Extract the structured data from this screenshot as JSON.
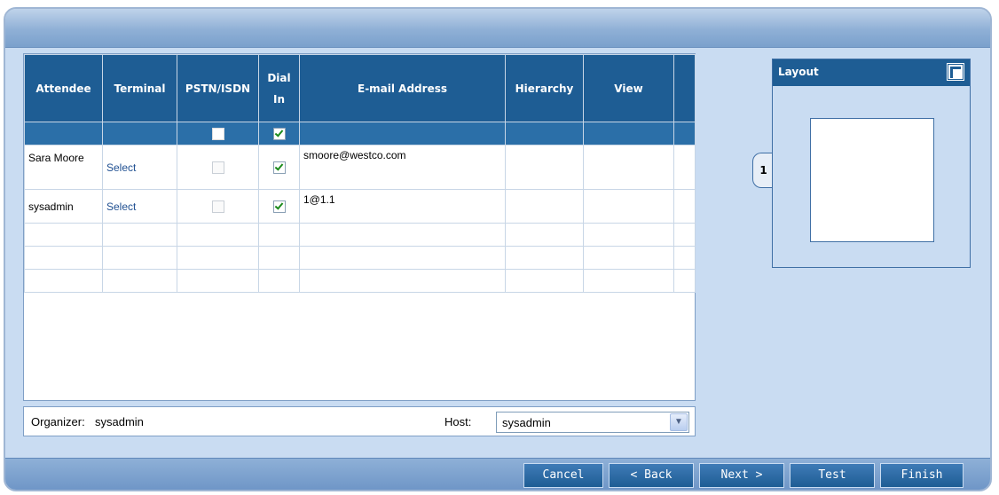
{
  "table": {
    "headers": [
      "Attendee",
      "Terminal",
      "PSTN/ISDN",
      "Dial In",
      "E-mail Address",
      "Hierarchy",
      "View"
    ],
    "select_all": {
      "pstn_checked": false,
      "dial_in_checked": true
    },
    "rows": [
      {
        "attendee": "Sara Moore",
        "terminal": "Select",
        "pstn_checked": false,
        "dial_in_checked": true,
        "email": "smoore@westco.com",
        "hierarchy": "",
        "view": ""
      },
      {
        "attendee": "sysadmin",
        "terminal": "Select",
        "pstn_checked": false,
        "dial_in_checked": true,
        "email": "1@1.1",
        "hierarchy": "",
        "view": ""
      }
    ]
  },
  "organizer": {
    "label": "Organizer:",
    "value": "sysadmin"
  },
  "host": {
    "label": "Host:",
    "value": "sysadmin"
  },
  "layout": {
    "title": "Layout",
    "page_number": "1"
  },
  "buttons": {
    "cancel": "Cancel",
    "back": "< Back",
    "next": "Next >",
    "test": "Test",
    "finish": "Finish"
  },
  "colors": {
    "header_blue": "#1e5d94",
    "panel_bg": "#c9dcf2",
    "check_green": "#1c8b1c"
  }
}
